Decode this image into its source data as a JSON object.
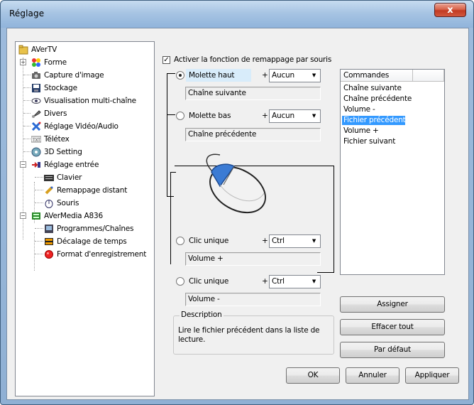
{
  "window": {
    "title": "Réglage",
    "close_label": "x"
  },
  "tree": {
    "root": "AVerTV",
    "items": [
      {
        "label": "Forme",
        "icon": "palette-icon"
      },
      {
        "label": "Capture d'image",
        "icon": "camera-icon"
      },
      {
        "label": "Stockage",
        "icon": "disk-icon"
      },
      {
        "label": "Visualisation multi-chaîne",
        "icon": "eye-icon"
      },
      {
        "label": "Divers",
        "icon": "wrench-icon"
      },
      {
        "label": "Réglage Vidéo/Audio",
        "icon": "tools-icon"
      },
      {
        "label": "Télétex",
        "icon": "teletext-icon"
      },
      {
        "label": "3D Setting",
        "icon": "3d-icon"
      },
      {
        "label": "Réglage entrée",
        "icon": "input-icon"
      },
      {
        "label": "Clavier",
        "icon": "keyboard-icon"
      },
      {
        "label": "Remappage distant",
        "icon": "remote-icon"
      },
      {
        "label": "Souris",
        "icon": "mouse-icon"
      },
      {
        "label": "AVerMedia A836",
        "icon": "device-icon"
      },
      {
        "label": "Programmes/Chaînes",
        "icon": "channel-icon"
      },
      {
        "label": "Décalage de temps",
        "icon": "timeshift-icon"
      },
      {
        "label": "Format d'enregistrement",
        "icon": "record-icon"
      }
    ]
  },
  "mapping": {
    "enable_label": "Activer la fonction de remappage par souris",
    "enable_checked": true,
    "plus": "+",
    "wheel_up": {
      "label": "Molette haut",
      "modifier": "Aucun",
      "action": "Chaîne suivante"
    },
    "wheel_down": {
      "label": "Molette bas",
      "modifier": "Aucun",
      "action": "Chaîne précédente"
    },
    "click1": {
      "label": "Clic unique",
      "modifier": "Ctrl",
      "action": "Volume +"
    },
    "click2": {
      "label": "Clic unique",
      "modifier": "Ctrl",
      "action": "Volume -"
    }
  },
  "commands": {
    "header": "Commandes",
    "items": [
      "Chaîne suivante",
      "Chaîne précédente",
      "Volume -",
      "Fichier précédent",
      "Volume +",
      "Fichier suivant"
    ],
    "selected": "Fichier précédent"
  },
  "description": {
    "legend": "Description",
    "text": "Lire le fichier précédent dans la liste de lecture."
  },
  "buttons": {
    "assign": "Assigner",
    "clear_all": "Effacer tout",
    "default": "Par défaut",
    "ok": "OK",
    "cancel": "Annuler",
    "apply": "Appliquer"
  },
  "colors": {
    "selection": "#3399ff",
    "mouse_wheel_highlight": "#3b7bd4",
    "close_button": "#c23a22"
  }
}
